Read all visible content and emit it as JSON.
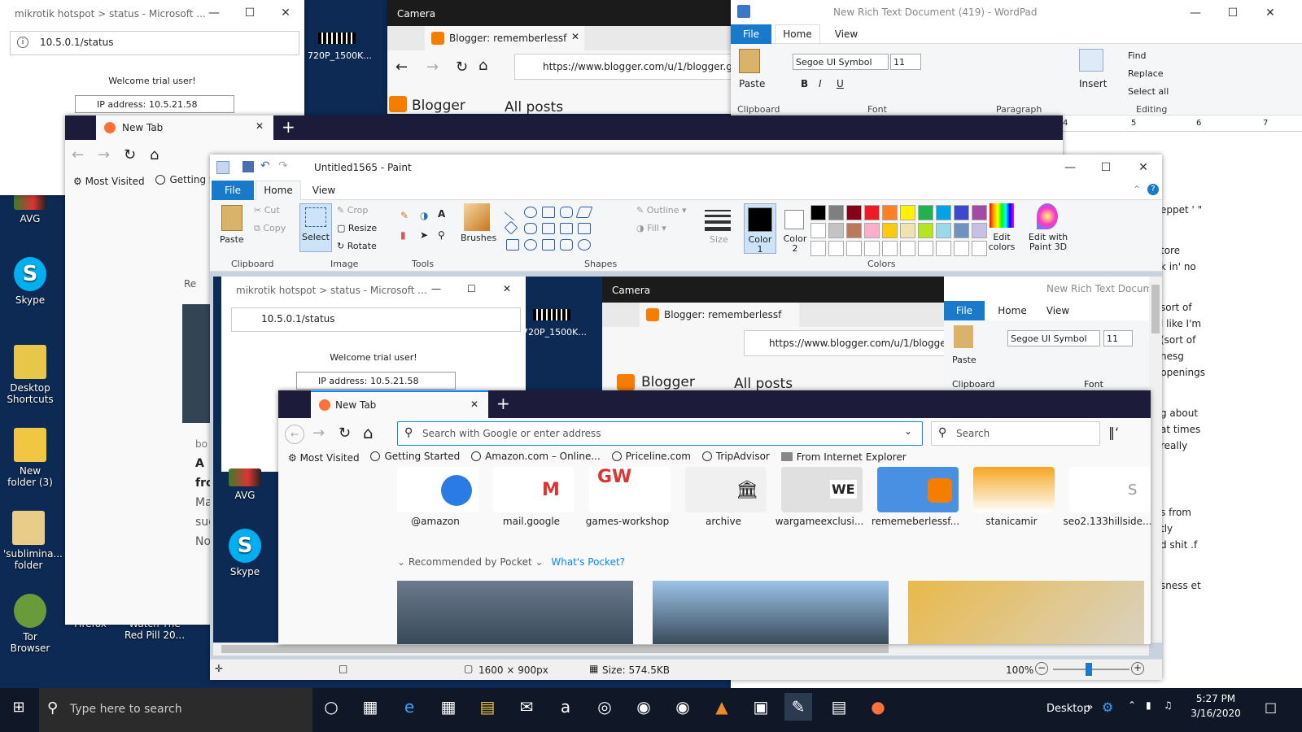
{
  "desktop": {
    "icons": [
      {
        "label": "AVG"
      },
      {
        "label": "Skype"
      },
      {
        "label": "Desktop Shortcuts"
      },
      {
        "label": "New folder (3)"
      },
      {
        "label": "'sublimina... folder"
      },
      {
        "label": "Tor Browser"
      },
      {
        "label": "Firefox"
      },
      {
        "label": "Watch The Red Pill 20..."
      }
    ],
    "video_thumb_label": "720P_1500K..."
  },
  "edge_back": {
    "title": "mikrotik hotspot > status - Microsoft ...",
    "address": "10.5.0.1/status",
    "welcome": "Welcome trial user!",
    "ip_label": "IP address:",
    "ip_value": "10.5.21.58"
  },
  "camera_back": {
    "title": "Camera",
    "tab_title": "Blogger: rememberlessf",
    "address": "https://www.blogger.com/u/1/blogger.g",
    "brand": "Blogger",
    "section": "All posts"
  },
  "wordpad": {
    "title": "New Rich Text Document (419) - WordPad",
    "tabs": [
      "File",
      "Home",
      "View"
    ],
    "font_name": "Segoe UI Symbol",
    "font_size": "11",
    "groups": {
      "clipboard": "Clipboard",
      "font": "Font",
      "paragraph": "Paragraph",
      "editing": "Editing"
    },
    "paste": "Paste",
    "insert": "Insert",
    "find": "Find",
    "replace": "Replace",
    "select_all": "Select all",
    "doc_lines": [
      "eppet ' \"",
      "tore",
      "k in' no",
      "sort of",
      "l like I'm",
      "(sort of",
      "nesg",
      "ppenings",
      "g about",
      "at times",
      "really",
      "s from",
      "tly",
      "d shit .f",
      "sness et"
    ],
    "ruler_marks": [
      "4",
      "5",
      "6",
      "7"
    ]
  },
  "firefox_back": {
    "tab_title": "New Tab",
    "search_placeholder": "Search with Google or enter address",
    "search_box": "Search",
    "bookmarks": [
      "Most Visited",
      "Getting Sta"
    ],
    "pocket_short": "Re",
    "story_lines": [
      "bo",
      "A",
      "fro",
      "Ma",
      "sug",
      "No"
    ]
  },
  "paint": {
    "title": "Untitled1565 - Paint",
    "tabs": [
      "File",
      "Home",
      "View"
    ],
    "clipboard": {
      "paste": "Paste",
      "cut": "Cut",
      "copy": "Copy",
      "label": "Clipboard"
    },
    "image": {
      "select": "Select",
      "crop": "Crop",
      "resize": "Resize",
      "rotate": "Rotate",
      "label": "Image"
    },
    "tools_label": "Tools",
    "brushes": "Brushes",
    "shapes": {
      "outline": "Outline",
      "fill": "Fill",
      "label": "Shapes"
    },
    "size": "Size",
    "color1": "Color 1",
    "color2": "Color 2",
    "edit_colors": "Edit colors",
    "edit_3d": "Edit with Paint 3D",
    "colors_label": "Colors",
    "palette_row1": [
      "#000000",
      "#7f7f7f",
      "#880015",
      "#ed1c24",
      "#ff7f27",
      "#fff200",
      "#22b14c",
      "#00a2e8",
      "#3f48cc",
      "#a349a4"
    ],
    "palette_row2": [
      "#ffffff",
      "#c3c3c3",
      "#b97a57",
      "#ffaec9",
      "#ffc90e",
      "#efe4b0",
      "#b5e61d",
      "#99d9ea",
      "#7092be",
      "#c8bfe7"
    ],
    "status": {
      "dimensions": "1600 × 900px",
      "size": "Size: 574.5KB",
      "zoom": "100%"
    }
  },
  "firefox_front": {
    "tab_title": "New Tab",
    "search_placeholder": "Search with Google or enter address",
    "search_box": "Search",
    "bookmarks": [
      "Most Visited",
      "Getting Started",
      "Amazon.com – Online...",
      "Priceline.com",
      "TripAdvisor",
      "From Internet Explorer"
    ],
    "top_sites": [
      "@amazon",
      "mail.google",
      "games-workshop",
      "archive",
      "wargameexclusi...",
      "rememeberlessf...",
      "stanicamir",
      "seo2.133hillside..."
    ],
    "pocket_heading": "Recommended by Pocket",
    "pocket_link": "What's Pocket?"
  },
  "taskbar": {
    "search_placeholder": "Type here to search",
    "desktop_label": "Desktop",
    "time": "5:27 PM",
    "date": "3/16/2020"
  }
}
